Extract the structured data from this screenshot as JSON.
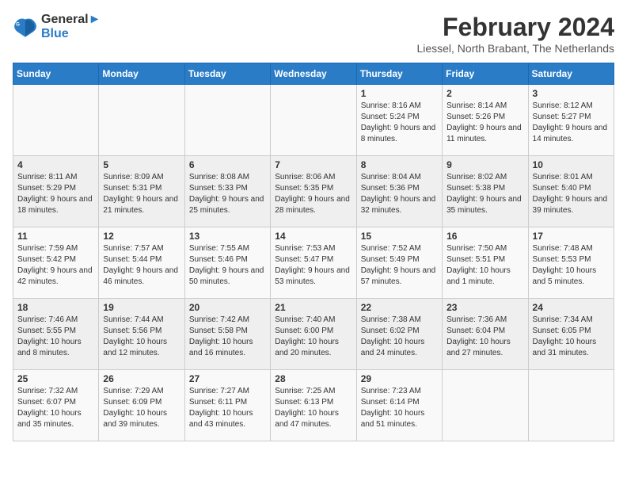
{
  "logo": {
    "line1": "General",
    "line2": "Blue"
  },
  "title": "February 2024",
  "location": "Liessel, North Brabant, The Netherlands",
  "days_header": [
    "Sunday",
    "Monday",
    "Tuesday",
    "Wednesday",
    "Thursday",
    "Friday",
    "Saturday"
  ],
  "weeks": [
    [
      {
        "day": "",
        "info": ""
      },
      {
        "day": "",
        "info": ""
      },
      {
        "day": "",
        "info": ""
      },
      {
        "day": "",
        "info": ""
      },
      {
        "day": "1",
        "info": "Sunrise: 8:16 AM\nSunset: 5:24 PM\nDaylight: 9 hours\nand 8 minutes."
      },
      {
        "day": "2",
        "info": "Sunrise: 8:14 AM\nSunset: 5:26 PM\nDaylight: 9 hours\nand 11 minutes."
      },
      {
        "day": "3",
        "info": "Sunrise: 8:12 AM\nSunset: 5:27 PM\nDaylight: 9 hours\nand 14 minutes."
      }
    ],
    [
      {
        "day": "4",
        "info": "Sunrise: 8:11 AM\nSunset: 5:29 PM\nDaylight: 9 hours\nand 18 minutes."
      },
      {
        "day": "5",
        "info": "Sunrise: 8:09 AM\nSunset: 5:31 PM\nDaylight: 9 hours\nand 21 minutes."
      },
      {
        "day": "6",
        "info": "Sunrise: 8:08 AM\nSunset: 5:33 PM\nDaylight: 9 hours\nand 25 minutes."
      },
      {
        "day": "7",
        "info": "Sunrise: 8:06 AM\nSunset: 5:35 PM\nDaylight: 9 hours\nand 28 minutes."
      },
      {
        "day": "8",
        "info": "Sunrise: 8:04 AM\nSunset: 5:36 PM\nDaylight: 9 hours\nand 32 minutes."
      },
      {
        "day": "9",
        "info": "Sunrise: 8:02 AM\nSunset: 5:38 PM\nDaylight: 9 hours\nand 35 minutes."
      },
      {
        "day": "10",
        "info": "Sunrise: 8:01 AM\nSunset: 5:40 PM\nDaylight: 9 hours\nand 39 minutes."
      }
    ],
    [
      {
        "day": "11",
        "info": "Sunrise: 7:59 AM\nSunset: 5:42 PM\nDaylight: 9 hours\nand 42 minutes."
      },
      {
        "day": "12",
        "info": "Sunrise: 7:57 AM\nSunset: 5:44 PM\nDaylight: 9 hours\nand 46 minutes."
      },
      {
        "day": "13",
        "info": "Sunrise: 7:55 AM\nSunset: 5:46 PM\nDaylight: 9 hours\nand 50 minutes."
      },
      {
        "day": "14",
        "info": "Sunrise: 7:53 AM\nSunset: 5:47 PM\nDaylight: 9 hours\nand 53 minutes."
      },
      {
        "day": "15",
        "info": "Sunrise: 7:52 AM\nSunset: 5:49 PM\nDaylight: 9 hours\nand 57 minutes."
      },
      {
        "day": "16",
        "info": "Sunrise: 7:50 AM\nSunset: 5:51 PM\nDaylight: 10 hours\nand 1 minute."
      },
      {
        "day": "17",
        "info": "Sunrise: 7:48 AM\nSunset: 5:53 PM\nDaylight: 10 hours\nand 5 minutes."
      }
    ],
    [
      {
        "day": "18",
        "info": "Sunrise: 7:46 AM\nSunset: 5:55 PM\nDaylight: 10 hours\nand 8 minutes."
      },
      {
        "day": "19",
        "info": "Sunrise: 7:44 AM\nSunset: 5:56 PM\nDaylight: 10 hours\nand 12 minutes."
      },
      {
        "day": "20",
        "info": "Sunrise: 7:42 AM\nSunset: 5:58 PM\nDaylight: 10 hours\nand 16 minutes."
      },
      {
        "day": "21",
        "info": "Sunrise: 7:40 AM\nSunset: 6:00 PM\nDaylight: 10 hours\nand 20 minutes."
      },
      {
        "day": "22",
        "info": "Sunrise: 7:38 AM\nSunset: 6:02 PM\nDaylight: 10 hours\nand 24 minutes."
      },
      {
        "day": "23",
        "info": "Sunrise: 7:36 AM\nSunset: 6:04 PM\nDaylight: 10 hours\nand 27 minutes."
      },
      {
        "day": "24",
        "info": "Sunrise: 7:34 AM\nSunset: 6:05 PM\nDaylight: 10 hours\nand 31 minutes."
      }
    ],
    [
      {
        "day": "25",
        "info": "Sunrise: 7:32 AM\nSunset: 6:07 PM\nDaylight: 10 hours\nand 35 minutes."
      },
      {
        "day": "26",
        "info": "Sunrise: 7:29 AM\nSunset: 6:09 PM\nDaylight: 10 hours\nand 39 minutes."
      },
      {
        "day": "27",
        "info": "Sunrise: 7:27 AM\nSunset: 6:11 PM\nDaylight: 10 hours\nand 43 minutes."
      },
      {
        "day": "28",
        "info": "Sunrise: 7:25 AM\nSunset: 6:13 PM\nDaylight: 10 hours\nand 47 minutes."
      },
      {
        "day": "29",
        "info": "Sunrise: 7:23 AM\nSunset: 6:14 PM\nDaylight: 10 hours\nand 51 minutes."
      },
      {
        "day": "",
        "info": ""
      },
      {
        "day": "",
        "info": ""
      }
    ]
  ]
}
